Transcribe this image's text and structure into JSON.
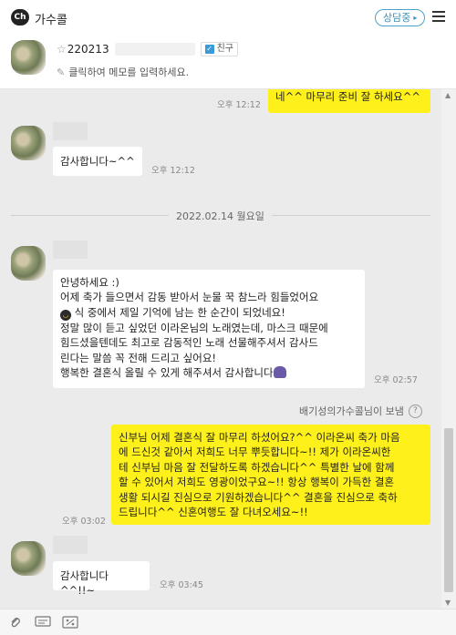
{
  "header": {
    "logo_text": "Ch",
    "channel_name": "가수콜",
    "status_label": "상담중",
    "status_caret": "▸",
    "menu_icon": "hamburger-icon"
  },
  "profile": {
    "star": "☆",
    "name_prefix": "220213",
    "friend_check": "✓",
    "friend_label": "친구",
    "pencil": "✎",
    "memo_placeholder": "클릭하여 메모를 입력하세요."
  },
  "chat": {
    "messages": [
      {
        "type": "sent",
        "text": "네^^ 마무리 준비 잘 하세요^^",
        "time": "오후 12:12"
      },
      {
        "type": "received",
        "text": "감사합니다~^^",
        "time": "오후 12:12"
      },
      {
        "type": "date",
        "text": "2022.02.14 월요일"
      },
      {
        "type": "received",
        "lines": [
          "안녕하세요 :)",
          "어제 축가 들으면서 감동 받아서 눈물 꾹 참느라 힘들었어요",
          "식 중에서 제일 기억에 남는 한 순간이 되었네요!",
          "정말 많이 듣고 싶었던 이라온님의 노래였는데, 마스크 때문에",
          "힘드셨을텐데도 최고로 감동적인 노래 선물해주셔서 감사드",
          "린다는 말씀 꼭 전해 드리고 싶어요!",
          "행복한 결혼식 올릴 수 있게 해주셔서 감사합니다"
        ],
        "time": "오후 02:57"
      },
      {
        "type": "note",
        "text": "배기성의가수콜님이 보냄",
        "help": "?"
      },
      {
        "type": "sent",
        "lines": [
          "신부님 어제 결혼식 잘 마무리 하셨어요?^^ 이라온씨 축가 마음",
          "에 드신것 같아서 저희도 너무 뿌듯합니다~!! 제가 이라온씨한",
          "테 신부님 마음 잘 전달하도록 하겠습니다^^ 특별한 날에 함께",
          "할 수 있어서 저희도 영광이었구요~!! 항상 행복이 가득한 결혼",
          "생활 되시길 진심으로 기원하겠습니다^^ 결혼을 진심으로 축하",
          "드립니다^^ 신혼여행도 잘 다녀오세요~!!"
        ],
        "time": "오후 03:02"
      },
      {
        "type": "received",
        "text": "감사합니다^^!!~",
        "time": "오후 03:45"
      }
    ]
  },
  "scrollbar": {
    "up": "▲",
    "down": "▼"
  },
  "toolbar": {
    "attach_icon": "paperclip-icon",
    "attach_glyph": "⌕",
    "message_icon": "speech-bubble-icon",
    "message_glyph": "▤",
    "capture_icon": "screenshot-icon",
    "capture_glyph": "▨"
  }
}
